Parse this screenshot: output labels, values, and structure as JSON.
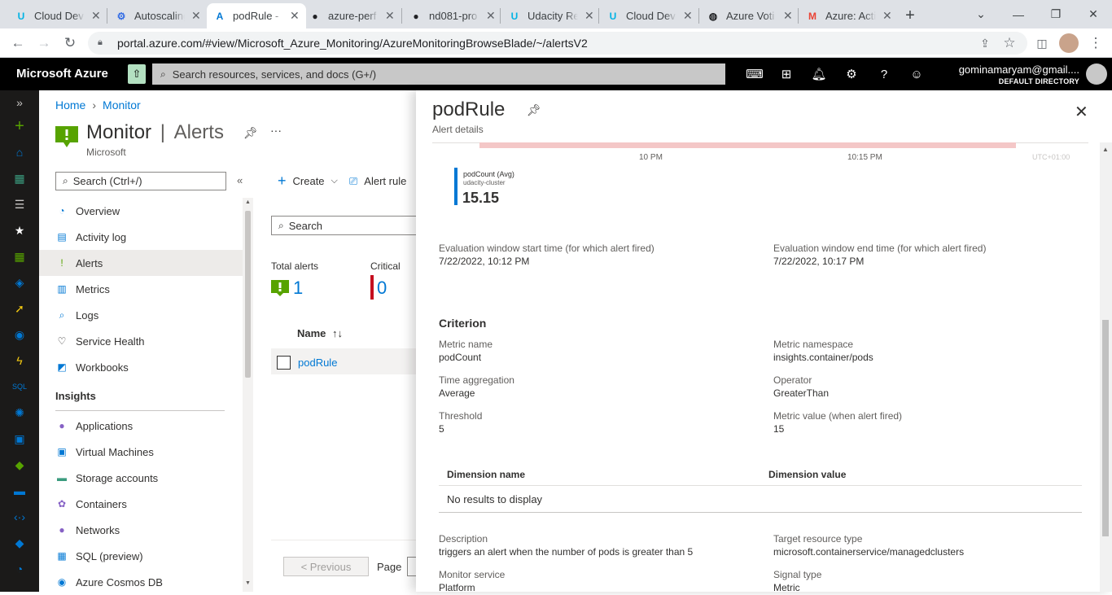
{
  "browser": {
    "tabs": [
      {
        "title": "Cloud Dev",
        "icon": "U"
      },
      {
        "title": "Autoscaling",
        "icon": "⚙"
      },
      {
        "title": "podRule - ",
        "icon": "A"
      },
      {
        "title": "azure-perf",
        "icon": "●"
      },
      {
        "title": "nd081-pro",
        "icon": "●"
      },
      {
        "title": "Udacity Re",
        "icon": "U"
      },
      {
        "title": "Cloud Dev",
        "icon": "U"
      },
      {
        "title": "Azure Voti",
        "icon": "◍"
      },
      {
        "title": "Azure: Acti",
        "icon": "M"
      }
    ],
    "url": "portal.azure.com/#view/Microsoft_Azure_Monitoring/AzureMonitoringBrowseBlade/~/alertsV2"
  },
  "azure": {
    "brand": "Microsoft Azure",
    "search_placeholder": "Search resources, services, and docs (G+/)",
    "user_email": "gominamaryam@gmail....",
    "user_directory": "DEFAULT DIRECTORY"
  },
  "breadcrumb": {
    "home": "Home",
    "monitor": "Monitor"
  },
  "monitor": {
    "title": "Monitor",
    "section": "Alerts",
    "subtitle": "Microsoft",
    "search_placeholder": "Search (Ctrl+/)",
    "menu": [
      {
        "label": "Overview",
        "icon": "◔",
        "color": "#0078d4"
      },
      {
        "label": "Activity log",
        "icon": "▤",
        "color": "#0078d4"
      },
      {
        "label": "Alerts",
        "icon": "!",
        "color": "#57a300"
      },
      {
        "label": "Metrics",
        "icon": "▥",
        "color": "#0078d4"
      },
      {
        "label": "Logs",
        "icon": "⌕",
        "color": "#0078d4"
      },
      {
        "label": "Service Health",
        "icon": "♡",
        "color": "#323130"
      },
      {
        "label": "Workbooks",
        "icon": "◩",
        "color": "#0078d4"
      }
    ],
    "insights_header": "Insights",
    "insights": [
      {
        "label": "Applications",
        "icon": "●",
        "color": "#8661c5"
      },
      {
        "label": "Virtual Machines",
        "icon": "▣",
        "color": "#0078d4"
      },
      {
        "label": "Storage accounts",
        "icon": "▬",
        "color": "#3b9b7e"
      },
      {
        "label": "Containers",
        "icon": "✿",
        "color": "#8661c5"
      },
      {
        "label": "Networks",
        "icon": "●",
        "color": "#8661c5"
      },
      {
        "label": "SQL (preview)",
        "icon": "▦",
        "color": "#0078d4"
      },
      {
        "label": "Azure Cosmos DB",
        "icon": "◉",
        "color": "#0078d4"
      }
    ]
  },
  "alerts_list": {
    "create_label": "Create",
    "alert_rules_label": "Alert rule",
    "search_placeholder": "Search",
    "total_alerts_label": "Total alerts",
    "total_alerts_value": "1",
    "critical_label": "Critical",
    "critical_value": "0",
    "name_col": "Name",
    "rows": [
      {
        "name": "podRule"
      }
    ],
    "prev_label": "< Previous",
    "page_label": "Page"
  },
  "details": {
    "title": "podRule",
    "subtitle": "Alert details",
    "chart_ticks": [
      "10 PM",
      "10:15 PM"
    ],
    "chart_tz": "UTC+01:00",
    "legend_metric": "podCount (Avg)",
    "legend_resource": "udacity-cluster",
    "legend_value": "15.15",
    "eval_start_label": "Evaluation window start time (for which alert fired)",
    "eval_start_value": "7/22/2022, 10:12 PM",
    "eval_end_label": "Evaluation window end time (for which alert fired)",
    "eval_end_value": "7/22/2022, 10:17 PM",
    "criterion_heading": "Criterion",
    "metric_name_label": "Metric name",
    "metric_name_value": "podCount",
    "metric_ns_label": "Metric namespace",
    "metric_ns_value": "insights.container/pods",
    "time_agg_label": "Time aggregation",
    "time_agg_value": "Average",
    "operator_label": "Operator",
    "operator_value": "GreaterThan",
    "threshold_label": "Threshold",
    "threshold_value": "5",
    "metric_value_label": "Metric value (when alert fired)",
    "metric_value_value": "15",
    "dim_name_header": "Dimension name",
    "dim_value_header": "Dimension value",
    "dim_empty": "No results to display",
    "description_label": "Description",
    "description_value": "triggers an alert when the number of pods is greater than 5",
    "target_type_label": "Target resource type",
    "target_type_value": "microsoft.containerservice/managedclusters",
    "monitor_service_label": "Monitor service",
    "monitor_service_value": "Platform",
    "signal_type_label": "Signal type",
    "signal_type_value": "Metric"
  }
}
